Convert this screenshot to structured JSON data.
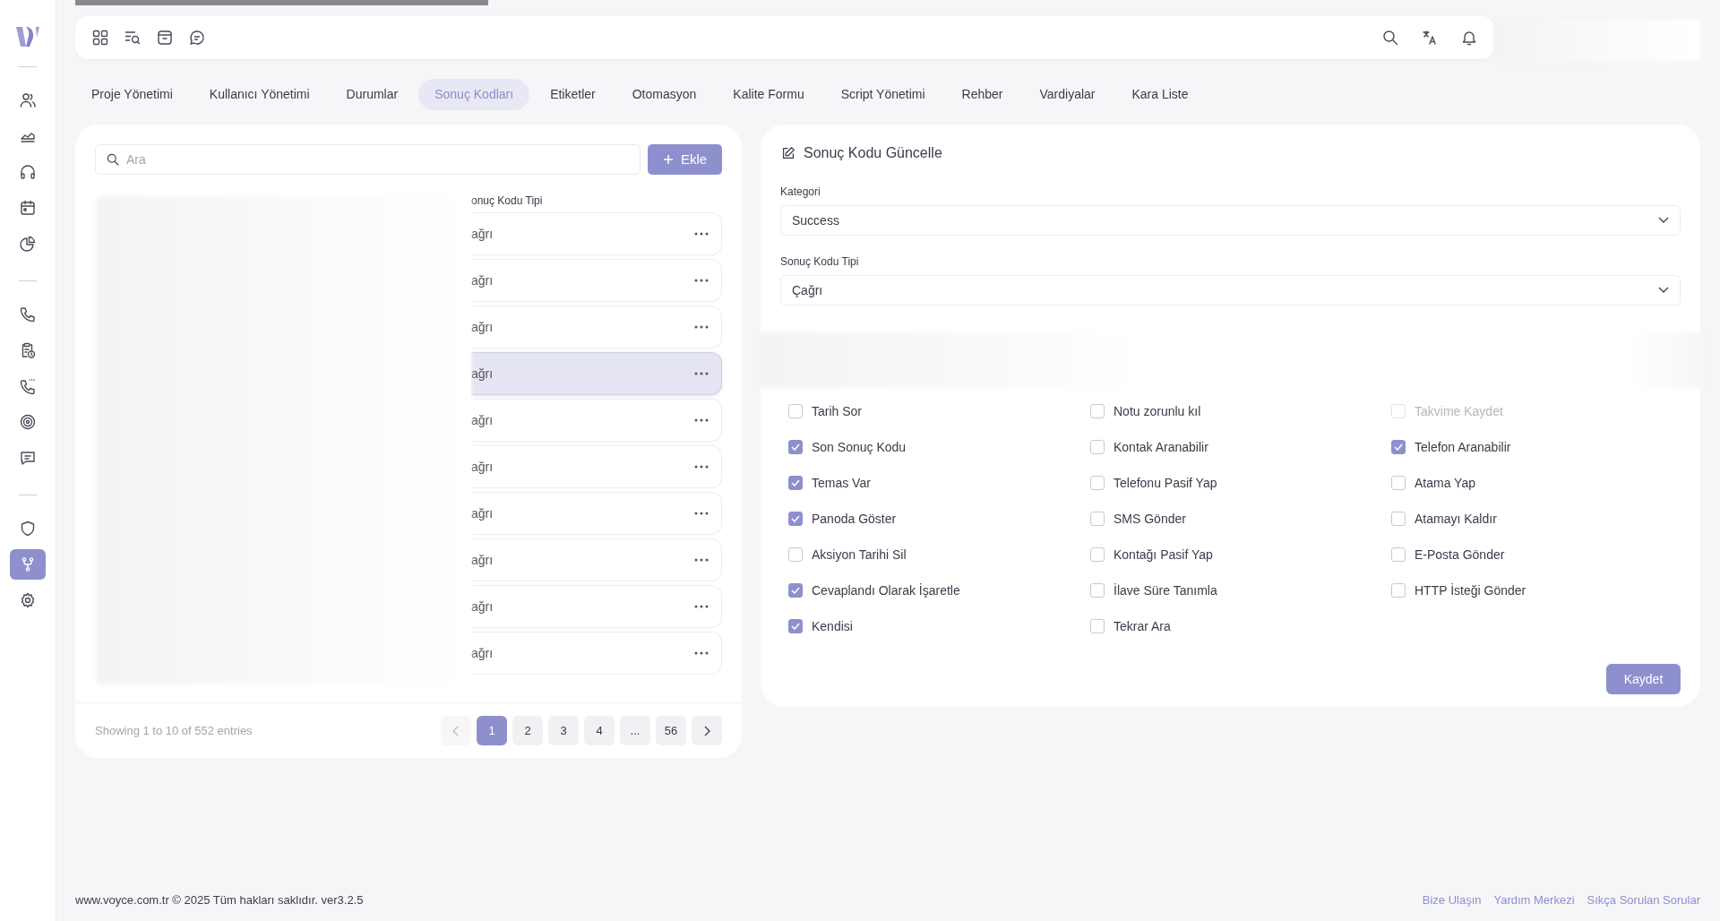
{
  "sidebar": {
    "groups": [
      {
        "items": [
          {
            "selected": false
          },
          {
            "selected": false
          },
          {
            "selected": false
          },
          {
            "selected": false
          },
          {
            "selected": false
          }
        ]
      },
      {
        "items": [
          {
            "selected": false
          },
          {
            "selected": false
          },
          {
            "selected": false
          },
          {
            "selected": false
          },
          {
            "selected": false
          }
        ]
      },
      {
        "items": [
          {
            "selected": false
          },
          {
            "selected": true
          },
          {
            "selected": false
          }
        ]
      }
    ]
  },
  "tabs": [
    {
      "label": "Proje Yönetimi",
      "selected": false
    },
    {
      "label": "Kullanıcı Yönetimi",
      "selected": false
    },
    {
      "label": "Durumlar",
      "selected": false
    },
    {
      "label": "Sonuç Kodları",
      "selected": true
    },
    {
      "label": "Etiketler",
      "selected": false
    },
    {
      "label": "Otomasyon",
      "selected": false
    },
    {
      "label": "Kalite Formu",
      "selected": false
    },
    {
      "label": "Script Yönetimi",
      "selected": false
    },
    {
      "label": "Rehber",
      "selected": false
    },
    {
      "label": "Vardiyalar",
      "selected": false
    },
    {
      "label": "Kara Liste",
      "selected": false
    }
  ],
  "list": {
    "search": {
      "placeholder": "Ara"
    },
    "add_button": "Ekle",
    "columns": {
      "column_2": "onuç Kodu Tipi"
    },
    "rows": [
      {
        "column_2": "ağrı",
        "selected": false
      },
      {
        "column_2": "ağrı",
        "selected": false
      },
      {
        "column_2": "ağrı",
        "selected": false
      },
      {
        "column_2": "ağrı",
        "selected": true
      },
      {
        "column_2": "ağrı",
        "selected": false
      },
      {
        "column_2": "ağrı",
        "selected": false
      },
      {
        "column_2": "ağrı",
        "selected": false
      },
      {
        "column_2": "ağrı",
        "selected": false
      },
      {
        "column_2": "ağrı",
        "selected": false
      },
      {
        "column_2": "ağrı",
        "selected": false
      }
    ],
    "summary": "Showing 1 to 10 of 552 entries",
    "pages": [
      {
        "label": "1",
        "selected": true
      },
      {
        "label": "2",
        "selected": false
      },
      {
        "label": "3",
        "selected": false
      },
      {
        "label": "4",
        "selected": false
      },
      {
        "label": "...",
        "selected": false
      },
      {
        "label": "56",
        "selected": false
      }
    ],
    "prev_disabled": true
  },
  "form": {
    "title": "Sonuç Kodu Güncelle",
    "fields": [
      {
        "label": "Kategori",
        "value": "Success"
      },
      {
        "label": "Sonuç Kodu Tipi",
        "value": "Çağrı"
      }
    ],
    "options": [
      {
        "label": "Tarih Sor",
        "checked": false,
        "disabled": false
      },
      {
        "label": "Notu zorunlu kıl",
        "checked": false,
        "disabled": false
      },
      {
        "label": "Takvime Kaydet",
        "checked": false,
        "disabled": true
      },
      {
        "label": "Son Sonuç Kodu",
        "checked": true,
        "disabled": false
      },
      {
        "label": "Kontak Aranabilir",
        "checked": false,
        "disabled": false
      },
      {
        "label": "Telefon Aranabilir",
        "checked": true,
        "disabled": false
      },
      {
        "label": "Temas Var",
        "checked": true,
        "disabled": false
      },
      {
        "label": "Telefonu Pasif Yap",
        "checked": false,
        "disabled": false
      },
      {
        "label": "Atama Yap",
        "checked": false,
        "disabled": false
      },
      {
        "label": "Panoda Göster",
        "checked": true,
        "disabled": false
      },
      {
        "label": "SMS Gönder",
        "checked": false,
        "disabled": false
      },
      {
        "label": "Atamayı Kaldır",
        "checked": false,
        "disabled": false
      },
      {
        "label": "Aksiyon Tarihi Sil",
        "checked": false,
        "disabled": false
      },
      {
        "label": "Kontağı Pasif Yap",
        "checked": false,
        "disabled": false
      },
      {
        "label": "E-Posta Gönder",
        "checked": false,
        "disabled": false
      },
      {
        "label": "Cevaplandı Olarak İşaretle",
        "checked": true,
        "disabled": false
      },
      {
        "label": "İlave Süre Tanımla",
        "checked": false,
        "disabled": false
      },
      {
        "label": "HTTP İsteği Gönder",
        "checked": false,
        "disabled": false
      },
      {
        "label": "Kendisi",
        "checked": true,
        "disabled": false
      },
      {
        "label": "Tekrar Ara",
        "checked": false,
        "disabled": false
      }
    ],
    "save_button": "Kaydet"
  },
  "footer": {
    "copyright": "www.voyce.com.tr © 2025 Tüm hakları saklıdır. ver3.2.5",
    "links": [
      "Bize Ulaşın",
      "Yardım Merkezi",
      "Sıkça Sorulan Sorular"
    ]
  }
}
